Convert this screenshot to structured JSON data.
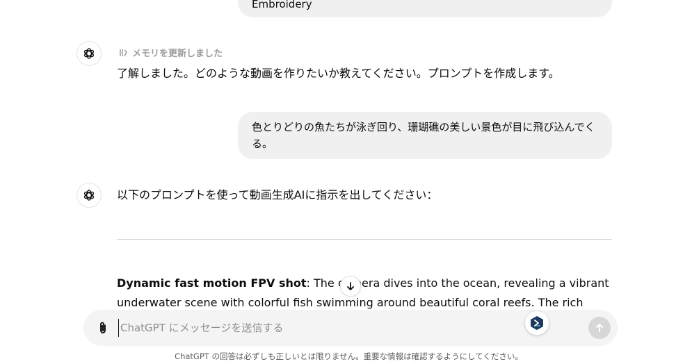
{
  "conversation": {
    "user_message_1": "Embroidery",
    "assistant_1": {
      "memory_notice": "メモリを更新しました",
      "text": "了解しました。どのような動画を作りたいか教えてください。プロンプトを作成します。"
    },
    "user_message_2": "色とりどりの魚たちが泳ぎ回り、珊瑚礁の美しい景色が目に飛び込んでくる。",
    "assistant_2": {
      "intro": "以下のプロンプトを使って動画生成AIに指示を出してください：",
      "prompt_bold": "Dynamic fast motion FPV shot",
      "prompt_text": ": The camera dives into the ocean, revealing a vibrant underwater scene with colorful fish swimming around beautiful coral reefs. The rich hues of the coral and the"
    }
  },
  "composer": {
    "placeholder": "ChatGPT にメッセージを送信する"
  },
  "footer": {
    "disclaimer": "ChatGPT の回答は必ずしも正しいとは限りません。重要な情報は確認するようにしてください。"
  },
  "icons": {
    "avatar": "openai-logo-icon",
    "memory": "memory-icon",
    "scroll": "arrow-down-icon",
    "attach": "paperclip-icon",
    "extension": "extension-logo-icon",
    "send": "arrow-up-icon"
  },
  "colors": {
    "bubble_bg": "#f0f0f0",
    "composer_bg": "#f4f4f4",
    "send_disabled": "#d7d7d7",
    "muted_text": "#9b9b9b",
    "extension_accent": "#1e3a5f"
  }
}
